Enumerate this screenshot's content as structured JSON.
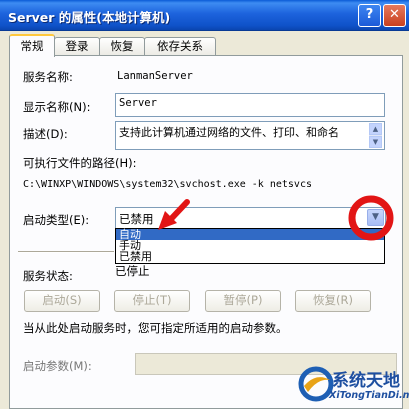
{
  "window": {
    "title": "Server 的属性(本地计算机)",
    "help_glyph": "?",
    "close_glyph": "✕"
  },
  "tabs": [
    {
      "label": "常规",
      "active": true
    },
    {
      "label": "登录"
    },
    {
      "label": "恢复"
    },
    {
      "label": "依存关系"
    }
  ],
  "general": {
    "service_name_label": "服务名称:",
    "service_name": "LanmanServer",
    "display_name_label": "显示名称(N):",
    "display_name": "Server",
    "description_label": "描述(D):",
    "description": "支持此计算机通过网络的文件、打印、和命名",
    "exe_path_label": "可执行文件的路径(H):",
    "exe_path": "C:\\WINXP\\WINDOWS\\system32\\svchost.exe -k netsvcs",
    "startup_type_label": "启动类型(E):",
    "startup_type_value": "已禁用",
    "startup_options": [
      "自动",
      "手动",
      "已禁用"
    ],
    "startup_highlighted_index": 0,
    "service_status_label": "服务状态:",
    "service_status": "已停止",
    "buttons": {
      "start": "启动(S)",
      "stop": "停止(T)",
      "pause": "暂停(P)",
      "resume": "恢复(R)"
    },
    "hint": "当从此处启动服务时，您可指定所适用的启动参数。",
    "start_params_label": "启动参数(M):",
    "start_params_value": ""
  },
  "annotations": {
    "arrow_color": "#e21515",
    "circle_color": "#e21515"
  },
  "watermark": {
    "cn": "系统天地",
    "en": "XiTongTianDi.net"
  }
}
